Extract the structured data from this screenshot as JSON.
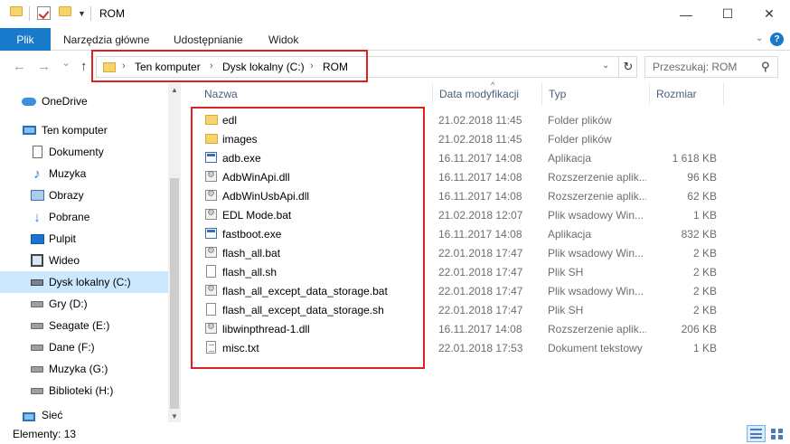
{
  "window": {
    "title": "ROM",
    "minimize_glyph": "—",
    "maximize_glyph": "☐",
    "close_glyph": "✕"
  },
  "ribbon": {
    "tabs": [
      {
        "label": "Plik"
      },
      {
        "label": "Narzędzia główne"
      },
      {
        "label": "Udostępnianie"
      },
      {
        "label": "Widok"
      }
    ],
    "help_glyph": "?"
  },
  "nav": {
    "back_glyph": "←",
    "forward_glyph": "→",
    "recent_glyph": "⌄",
    "up_glyph": "↑",
    "breadcrumb": [
      {
        "label": "Ten komputer"
      },
      {
        "label": "Dysk lokalny (C:)"
      },
      {
        "label": "ROM"
      }
    ],
    "crumb_separator": "›",
    "search_placeholder": "Przeszukaj: ROM"
  },
  "sidebar": {
    "items": [
      {
        "label": "OneDrive",
        "icon": "cloud-icon"
      },
      {
        "label": "Ten komputer",
        "icon": "computer-icon"
      },
      {
        "label": "Dokumenty",
        "icon": "documents-icon"
      },
      {
        "label": "Muzyka",
        "icon": "music-icon"
      },
      {
        "label": "Obrazy",
        "icon": "pictures-icon"
      },
      {
        "label": "Pobrane",
        "icon": "downloads-icon"
      },
      {
        "label": "Pulpit",
        "icon": "desktop-icon"
      },
      {
        "label": "Wideo",
        "icon": "video-icon"
      },
      {
        "label": "Dysk lokalny (C:)",
        "icon": "drive-icon",
        "selected": true
      },
      {
        "label": "Gry (D:)",
        "icon": "drive-icon"
      },
      {
        "label": "Seagate (E:)",
        "icon": "drive-icon"
      },
      {
        "label": "Dane (F:)",
        "icon": "drive-icon"
      },
      {
        "label": "Muzyka (G:)",
        "icon": "drive-icon"
      },
      {
        "label": "Biblioteki (H:)",
        "icon": "drive-icon"
      },
      {
        "label": "Sieć",
        "icon": "network-icon"
      }
    ]
  },
  "list": {
    "columns": {
      "name": "Nazwa",
      "date": "Data modyfikacji",
      "type": "Typ",
      "size": "Rozmiar"
    },
    "files": [
      {
        "name": "edl",
        "date": "21.02.2018 11:45",
        "type": "Folder plików",
        "size": "",
        "kind": "folder"
      },
      {
        "name": "images",
        "date": "21.02.2018 11:45",
        "type": "Folder plików",
        "size": "",
        "kind": "folder"
      },
      {
        "name": "adb.exe",
        "date": "16.11.2017 14:08",
        "type": "Aplikacja",
        "size": "1 618 KB",
        "kind": "exe"
      },
      {
        "name": "AdbWinApi.dll",
        "date": "16.11.2017 14:08",
        "type": "Rozszerzenie aplik...",
        "size": "96 KB",
        "kind": "dll"
      },
      {
        "name": "AdbWinUsbApi.dll",
        "date": "16.11.2017 14:08",
        "type": "Rozszerzenie aplik...",
        "size": "62 KB",
        "kind": "dll"
      },
      {
        "name": "EDL Mode.bat",
        "date": "21.02.2018 12:07",
        "type": "Plik wsadowy Win...",
        "size": "1 KB",
        "kind": "bat"
      },
      {
        "name": "fastboot.exe",
        "date": "16.11.2017 14:08",
        "type": "Aplikacja",
        "size": "832 KB",
        "kind": "exe"
      },
      {
        "name": "flash_all.bat",
        "date": "22.01.2018 17:47",
        "type": "Plik wsadowy Win...",
        "size": "2 KB",
        "kind": "bat"
      },
      {
        "name": "flash_all.sh",
        "date": "22.01.2018 17:47",
        "type": "Plik SH",
        "size": "2 KB",
        "kind": "sh"
      },
      {
        "name": "flash_all_except_data_storage.bat",
        "date": "22.01.2018 17:47",
        "type": "Plik wsadowy Win...",
        "size": "2 KB",
        "kind": "bat"
      },
      {
        "name": "flash_all_except_data_storage.sh",
        "date": "22.01.2018 17:47",
        "type": "Plik SH",
        "size": "2 KB",
        "kind": "sh"
      },
      {
        "name": "libwinpthread-1.dll",
        "date": "16.11.2017 14:08",
        "type": "Rozszerzenie aplik...",
        "size": "206 KB",
        "kind": "dll"
      },
      {
        "name": "misc.txt",
        "date": "22.01.2018 17:53",
        "type": "Dokument tekstowy",
        "size": "1 KB",
        "kind": "txt"
      }
    ]
  },
  "status": {
    "text": "Elementy: 13"
  },
  "colors": {
    "accent": "#1979ca",
    "selection": "#cce8ff",
    "highlight": "#e02020"
  }
}
